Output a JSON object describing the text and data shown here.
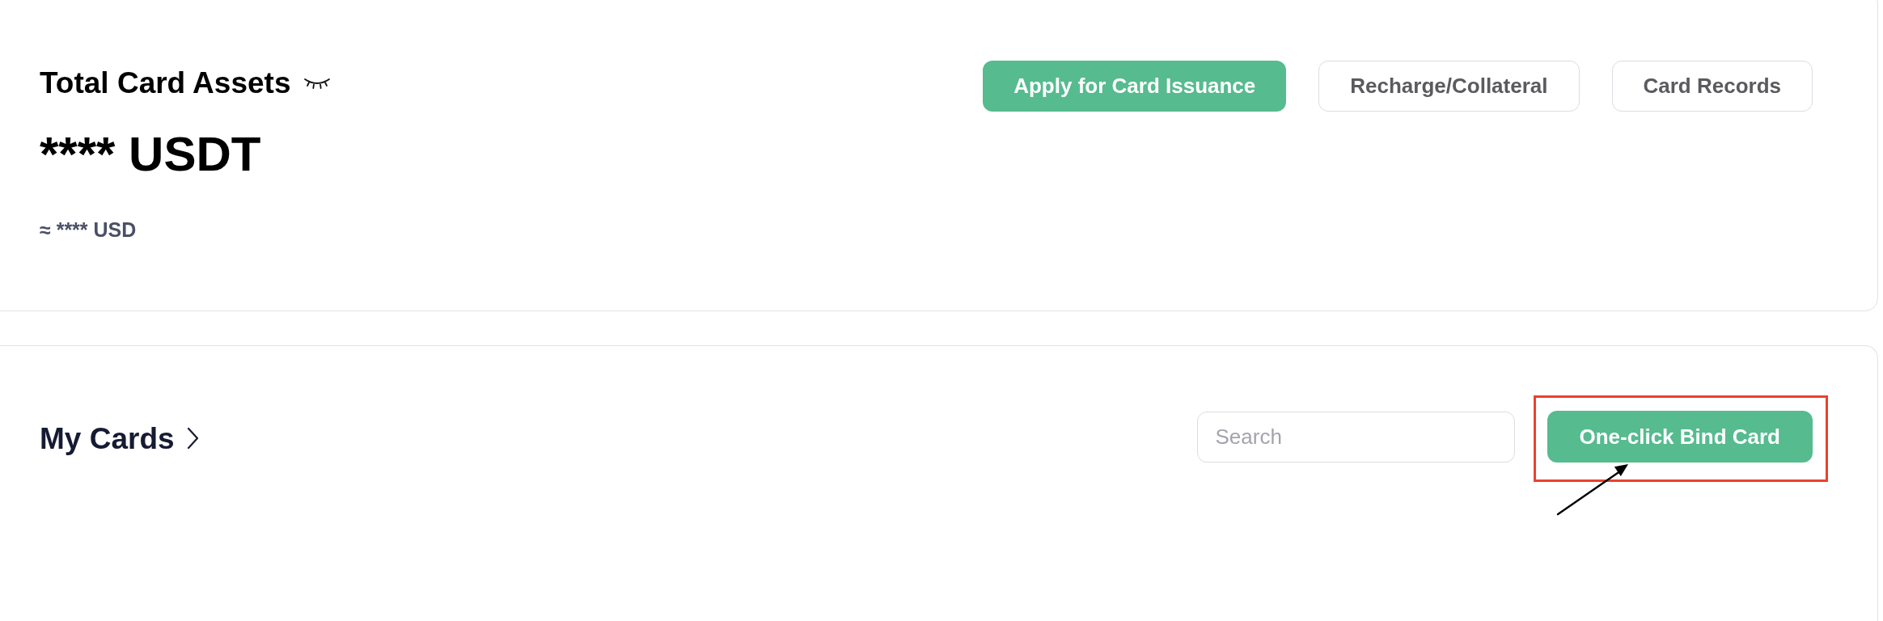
{
  "summary": {
    "title": "Total Card Assets",
    "balance_hidden": true,
    "amount": "**** USDT",
    "approx": "≈ **** USD",
    "actions": [
      {
        "label": "Apply for Card Issuance",
        "primary": true
      },
      {
        "label": "Recharge/Collateral",
        "primary": false
      },
      {
        "label": "Card Records",
        "primary": false
      }
    ]
  },
  "my_cards": {
    "title": "My Cards",
    "search": {
      "placeholder": "Search"
    },
    "bind_button": {
      "label": "One-click Bind Card",
      "highlighted": true
    }
  }
}
